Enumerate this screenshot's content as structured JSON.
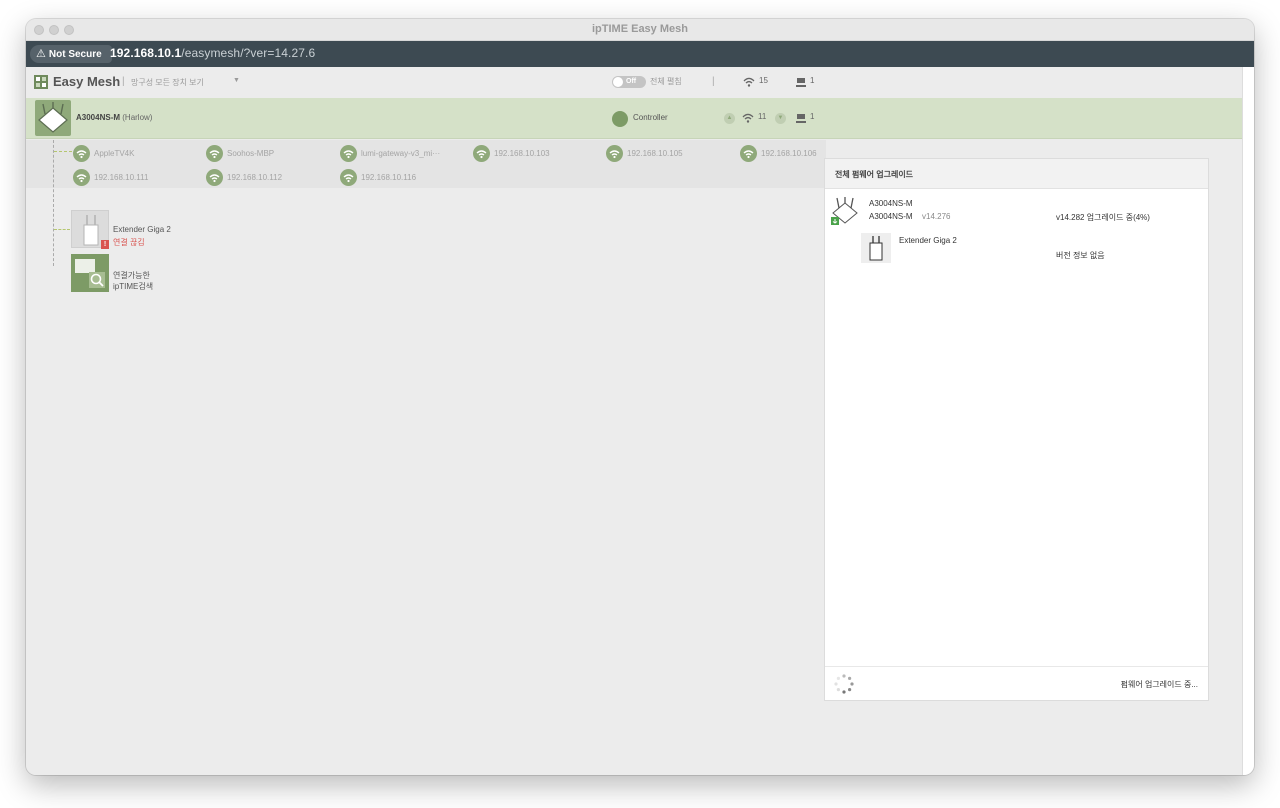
{
  "window": {
    "title": "ipTIME Easy Mesh"
  },
  "browser": {
    "security_label": "Not Secure",
    "url_host": "192.168.10.1",
    "url_path": "/easymesh/?ver=14.27.6"
  },
  "toolbar": {
    "app_name": "Easy Mesh",
    "filter_label": "망구성 모든 장치 보기",
    "toggle_state": "Off",
    "toggle_label": "전체 펼침",
    "wifi_count": "15",
    "wired_count": "1"
  },
  "router": {
    "model": "A3004NS-M",
    "nickname": "(Harlow)",
    "role": "Controller",
    "wifi_count": "11",
    "wired_count": "1"
  },
  "clients": [
    {
      "label": "AppleTV4K"
    },
    {
      "label": "Soohos-MBP"
    },
    {
      "label": "lumi-gateway-v3_mi···"
    },
    {
      "label": "192.168.10.103"
    },
    {
      "label": "192.168.10.105"
    },
    {
      "label": "192.168.10.106"
    },
    {
      "label": "192.168.10.111"
    },
    {
      "label": "192.168.10.112"
    },
    {
      "label": "192.168.10.116"
    }
  ],
  "extender": {
    "name": "Extender Giga 2",
    "status": "연결 끊김"
  },
  "search": {
    "line1": "연결가능한",
    "line2": "ipTIME검색"
  },
  "firmware_panel": {
    "title": "전체 펌웨어 업그레이드",
    "devices": [
      {
        "name": "A3004NS-M",
        "model": "A3004NS-M",
        "version": "v14.276",
        "status": "v14.282 업그레이드 중(4%)"
      },
      {
        "name": "Extender Giga 2",
        "status": "버전 정보 없음"
      }
    ],
    "footer_text": "펌웨어 업그레이드 중..."
  },
  "colors": {
    "accent_green": "#8fa97a",
    "row_highlight": "#d5e1c8",
    "url_bar": "#3d4a52",
    "error_red": "#d9534f"
  }
}
